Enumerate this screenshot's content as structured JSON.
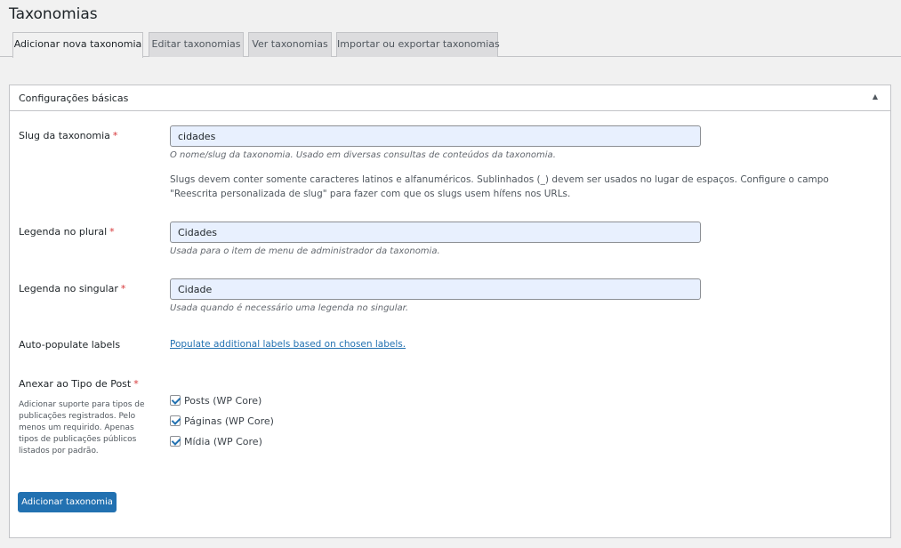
{
  "page": {
    "title": "Taxonomias"
  },
  "tabs": [
    {
      "label": "Adicionar nova taxonomia",
      "active": true
    },
    {
      "label": "Editar taxonomias",
      "active": false
    },
    {
      "label": "Ver taxonomias",
      "active": false
    },
    {
      "label": "Importar ou exportar taxonomias",
      "active": false
    }
  ],
  "panel": {
    "title": "Configurações básicas",
    "toggle_icon": "triangle-up"
  },
  "fields": {
    "slug": {
      "label": "Slug da taxonomia",
      "required": "*",
      "value": "cidades",
      "description": "O nome/slug da taxonomia. Usado em diversas consultas de conteúdos da taxonomia.",
      "note": "Slugs devem conter somente caracteres latinos e alfanuméricos. Sublinhados (_) devem ser usados no lugar de espaços. Configure o campo \"Reescrita personalizada de slug\" para fazer com que os slugs usem hífens nos URLs."
    },
    "plural": {
      "label": "Legenda no plural",
      "required": "*",
      "value": "Cidades",
      "description": "Usada para o item de menu de administrador da taxonomia."
    },
    "singular": {
      "label": "Legenda no singular",
      "required": "*",
      "value": "Cidade",
      "description": "Usada quando é necessário uma legenda no singular."
    },
    "auto_populate": {
      "label": "Auto-populate labels",
      "link": "Populate additional labels based on chosen labels."
    },
    "post_types": {
      "label": "Anexar ao Tipo de Post",
      "required": "*",
      "help": "Adicionar suporte para tipos de publicações registrados. Pelo menos um requirido. Apenas tipos de publicações públicos listados por padrão.",
      "options": [
        {
          "label": "Posts (WP Core)",
          "checked": true
        },
        {
          "label": "Páginas (WP Core)",
          "checked": true
        },
        {
          "label": "Mídia (WP Core)",
          "checked": true
        }
      ]
    }
  },
  "submit": {
    "label": "Adicionar taxonomia"
  },
  "colors": {
    "accent": "#2271b1",
    "required": "#d63638",
    "autofill_bg": "#e8f0fe"
  }
}
